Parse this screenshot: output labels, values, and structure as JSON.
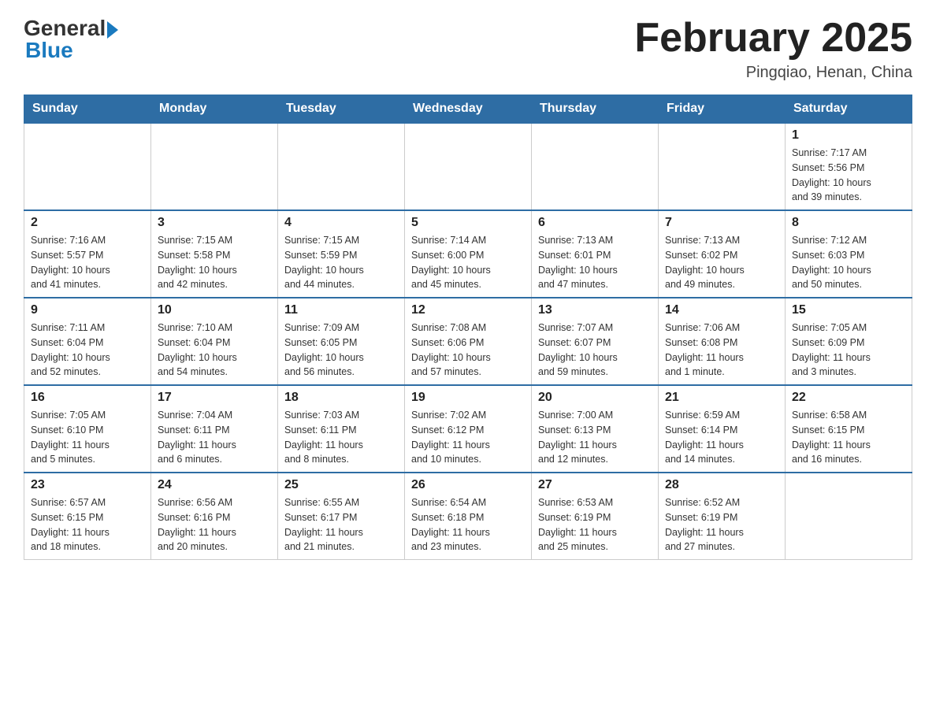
{
  "header": {
    "logo_general": "General",
    "logo_blue": "Blue",
    "title": "February 2025",
    "location": "Pingqiao, Henan, China"
  },
  "weekdays": [
    "Sunday",
    "Monday",
    "Tuesday",
    "Wednesday",
    "Thursday",
    "Friday",
    "Saturday"
  ],
  "weeks": [
    {
      "days": [
        {
          "number": "",
          "info": ""
        },
        {
          "number": "",
          "info": ""
        },
        {
          "number": "",
          "info": ""
        },
        {
          "number": "",
          "info": ""
        },
        {
          "number": "",
          "info": ""
        },
        {
          "number": "",
          "info": ""
        },
        {
          "number": "1",
          "info": "Sunrise: 7:17 AM\nSunset: 5:56 PM\nDaylight: 10 hours\nand 39 minutes."
        }
      ]
    },
    {
      "days": [
        {
          "number": "2",
          "info": "Sunrise: 7:16 AM\nSunset: 5:57 PM\nDaylight: 10 hours\nand 41 minutes."
        },
        {
          "number": "3",
          "info": "Sunrise: 7:15 AM\nSunset: 5:58 PM\nDaylight: 10 hours\nand 42 minutes."
        },
        {
          "number": "4",
          "info": "Sunrise: 7:15 AM\nSunset: 5:59 PM\nDaylight: 10 hours\nand 44 minutes."
        },
        {
          "number": "5",
          "info": "Sunrise: 7:14 AM\nSunset: 6:00 PM\nDaylight: 10 hours\nand 45 minutes."
        },
        {
          "number": "6",
          "info": "Sunrise: 7:13 AM\nSunset: 6:01 PM\nDaylight: 10 hours\nand 47 minutes."
        },
        {
          "number": "7",
          "info": "Sunrise: 7:13 AM\nSunset: 6:02 PM\nDaylight: 10 hours\nand 49 minutes."
        },
        {
          "number": "8",
          "info": "Sunrise: 7:12 AM\nSunset: 6:03 PM\nDaylight: 10 hours\nand 50 minutes."
        }
      ]
    },
    {
      "days": [
        {
          "number": "9",
          "info": "Sunrise: 7:11 AM\nSunset: 6:04 PM\nDaylight: 10 hours\nand 52 minutes."
        },
        {
          "number": "10",
          "info": "Sunrise: 7:10 AM\nSunset: 6:04 PM\nDaylight: 10 hours\nand 54 minutes."
        },
        {
          "number": "11",
          "info": "Sunrise: 7:09 AM\nSunset: 6:05 PM\nDaylight: 10 hours\nand 56 minutes."
        },
        {
          "number": "12",
          "info": "Sunrise: 7:08 AM\nSunset: 6:06 PM\nDaylight: 10 hours\nand 57 minutes."
        },
        {
          "number": "13",
          "info": "Sunrise: 7:07 AM\nSunset: 6:07 PM\nDaylight: 10 hours\nand 59 minutes."
        },
        {
          "number": "14",
          "info": "Sunrise: 7:06 AM\nSunset: 6:08 PM\nDaylight: 11 hours\nand 1 minute."
        },
        {
          "number": "15",
          "info": "Sunrise: 7:05 AM\nSunset: 6:09 PM\nDaylight: 11 hours\nand 3 minutes."
        }
      ]
    },
    {
      "days": [
        {
          "number": "16",
          "info": "Sunrise: 7:05 AM\nSunset: 6:10 PM\nDaylight: 11 hours\nand 5 minutes."
        },
        {
          "number": "17",
          "info": "Sunrise: 7:04 AM\nSunset: 6:11 PM\nDaylight: 11 hours\nand 6 minutes."
        },
        {
          "number": "18",
          "info": "Sunrise: 7:03 AM\nSunset: 6:11 PM\nDaylight: 11 hours\nand 8 minutes."
        },
        {
          "number": "19",
          "info": "Sunrise: 7:02 AM\nSunset: 6:12 PM\nDaylight: 11 hours\nand 10 minutes."
        },
        {
          "number": "20",
          "info": "Sunrise: 7:00 AM\nSunset: 6:13 PM\nDaylight: 11 hours\nand 12 minutes."
        },
        {
          "number": "21",
          "info": "Sunrise: 6:59 AM\nSunset: 6:14 PM\nDaylight: 11 hours\nand 14 minutes."
        },
        {
          "number": "22",
          "info": "Sunrise: 6:58 AM\nSunset: 6:15 PM\nDaylight: 11 hours\nand 16 minutes."
        }
      ]
    },
    {
      "days": [
        {
          "number": "23",
          "info": "Sunrise: 6:57 AM\nSunset: 6:15 PM\nDaylight: 11 hours\nand 18 minutes."
        },
        {
          "number": "24",
          "info": "Sunrise: 6:56 AM\nSunset: 6:16 PM\nDaylight: 11 hours\nand 20 minutes."
        },
        {
          "number": "25",
          "info": "Sunrise: 6:55 AM\nSunset: 6:17 PM\nDaylight: 11 hours\nand 21 minutes."
        },
        {
          "number": "26",
          "info": "Sunrise: 6:54 AM\nSunset: 6:18 PM\nDaylight: 11 hours\nand 23 minutes."
        },
        {
          "number": "27",
          "info": "Sunrise: 6:53 AM\nSunset: 6:19 PM\nDaylight: 11 hours\nand 25 minutes."
        },
        {
          "number": "28",
          "info": "Sunrise: 6:52 AM\nSunset: 6:19 PM\nDaylight: 11 hours\nand 27 minutes."
        },
        {
          "number": "",
          "info": ""
        }
      ]
    }
  ]
}
